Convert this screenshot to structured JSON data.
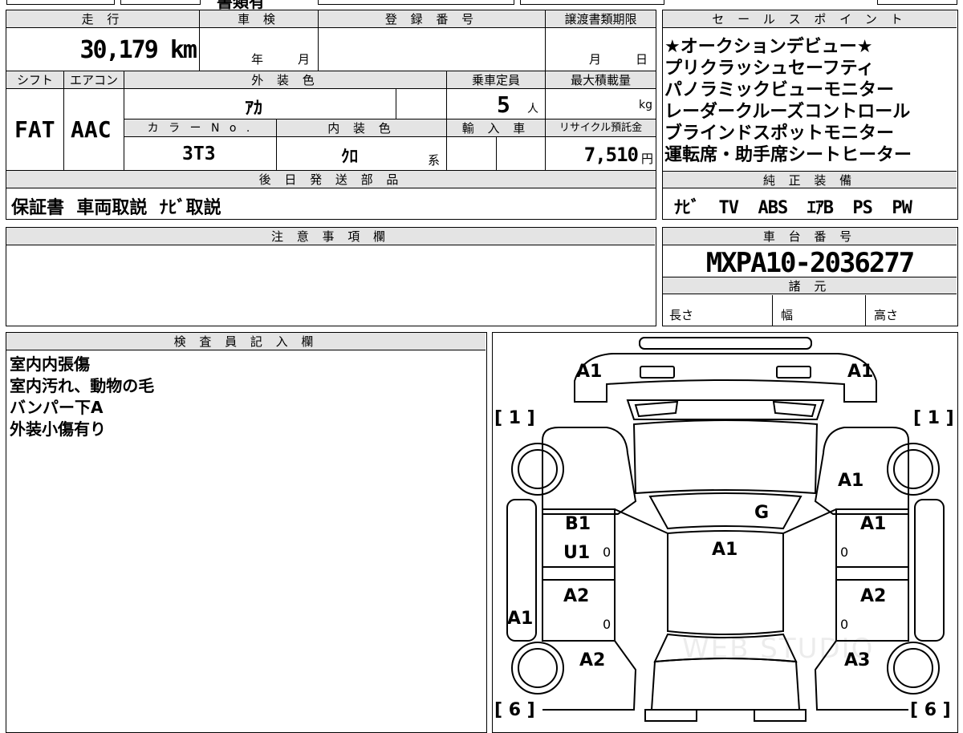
{
  "top_strip": {
    "partial_text": "書類有"
  },
  "main_table": {
    "mileage_label": "走 行",
    "mileage_value": "30,179 km",
    "inspection_label": "車 検",
    "inspection_year_unit": "年",
    "inspection_month_unit": "月",
    "registration_label": "登 録 番 号",
    "registration_value": "",
    "transfer_deadline_label": "譲渡書類期限",
    "transfer_month_unit": "月",
    "transfer_day_unit": "日",
    "shift_label": "シフト",
    "shift_value": "FAT",
    "aircon_label": "エアコン",
    "aircon_value": "AAC",
    "exterior_color_label": "外 装 色",
    "exterior_color_value": "ｱｶ",
    "capacity_label": "乗車定員",
    "capacity_value": "5",
    "capacity_unit": "人",
    "max_load_label": "最大積載量",
    "max_load_unit": "kg",
    "color_no_label": "カ ラ ー N o .",
    "color_no_value": "3T3",
    "interior_color_label": "内 装 色",
    "interior_color_value": "ｸﾛ",
    "interior_color_suffix": "系",
    "import_label": "輸 入 車",
    "recycle_label": "リサイクル預託金",
    "recycle_value": "7,510",
    "recycle_unit": "円",
    "shipping_label": "後 日 発 送 部 品",
    "shipping_value": "保証書  車両取説  ﾅﾋﾞ取説"
  },
  "sales_points": {
    "label": "セ ー ル ス ポ イ ン ト",
    "items": [
      "★オークションデビュー★",
      "プリクラッシュセーフティ",
      "パノラミックビューモニター",
      "レーダークルーズコントロール",
      "ブラインドスポットモニター",
      "運転席・助手席シートヒーター"
    ]
  },
  "genuine_equipment": {
    "label": "純 正 装 備",
    "value": "ﾅﾋﾞ  TV  ABS  ｴｱB  PS  PW"
  },
  "notes": {
    "label": "注 意 事 項 欄",
    "value": ""
  },
  "chassis": {
    "label": "車 台 番 号",
    "value": "MXPA10-2036277",
    "specs_label": "諸 元",
    "length_label": "長さ",
    "width_label": "幅",
    "height_label": "高さ"
  },
  "inspector": {
    "label": "検 査 員 記 入 欄",
    "lines": [
      "室内内張傷",
      "室内汚れ、動物の毛",
      "バンパー下A",
      "外装小傷有り"
    ]
  },
  "diagram": {
    "marks": {
      "front_left": "A1",
      "front_right": "A1",
      "tire_front_left": "[ 1 ]",
      "tire_front_right": "[ 1 ]",
      "fender_right": "A1",
      "windshield": "G",
      "door_left_front_1": "B1",
      "door_left_front_2": "U1",
      "door_right_front": "A1",
      "roof": "A1",
      "door_left_rear": "A2",
      "door_right_rear": "A2",
      "side_left": "A1",
      "rear_left": "A2",
      "rear_right": "A3",
      "tire_rear_left": "[ 6 ]",
      "tire_rear_right": "[ 6 ]",
      "zero_1": "0",
      "zero_2": "0",
      "zero_3": "0",
      "zero_4": "0"
    },
    "watermark": "WEB STUDIO"
  }
}
